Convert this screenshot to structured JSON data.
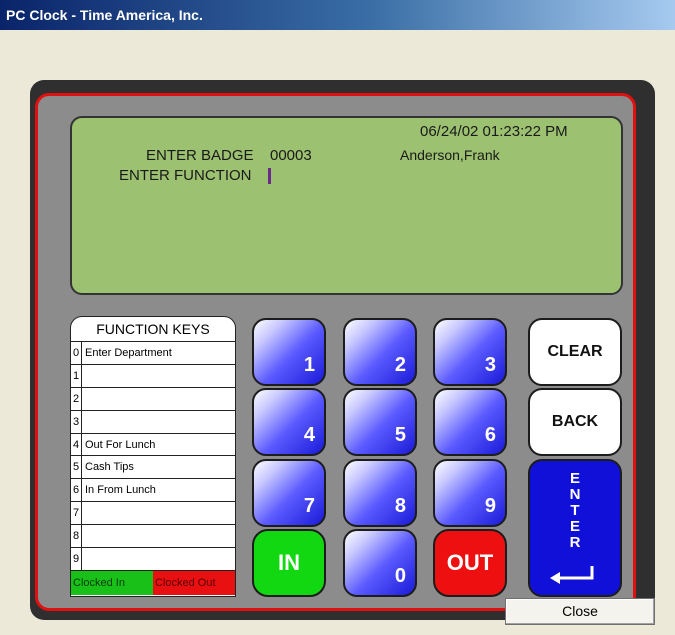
{
  "window": {
    "title": "PC Clock - Time America, Inc."
  },
  "display": {
    "datetime": "06/24/02 01:23:22 PM",
    "badge_label": "ENTER BADGE",
    "badge_value": "00003",
    "employee_name": "Anderson,Frank",
    "function_label": "ENTER FUNCTION"
  },
  "function_keys": {
    "title": "FUNCTION KEYS",
    "rows": [
      {
        "num": "0",
        "label": "Enter Department"
      },
      {
        "num": "1",
        "label": ""
      },
      {
        "num": "2",
        "label": ""
      },
      {
        "num": "3",
        "label": ""
      },
      {
        "num": "4",
        "label": "Out For Lunch"
      },
      {
        "num": "5",
        "label": "Cash Tips"
      },
      {
        "num": "6",
        "label": "In From Lunch"
      },
      {
        "num": "7",
        "label": ""
      },
      {
        "num": "8",
        "label": ""
      },
      {
        "num": "9",
        "label": ""
      }
    ],
    "status_in": "Clocked In",
    "status_out": "Clocked Out"
  },
  "keypad": {
    "k1": "1",
    "k2": "2",
    "k3": "3",
    "k4": "4",
    "k5": "5",
    "k6": "6",
    "k7": "7",
    "k8": "8",
    "k9": "9",
    "k0": "0",
    "in": "IN",
    "out": "OUT",
    "clear": "CLEAR",
    "back": "BACK",
    "enter": [
      "E",
      "N",
      "T",
      "E",
      "R"
    ]
  },
  "footer": {
    "close": "Close"
  },
  "colors": {
    "lcd": "#9cc170",
    "panel_border": "#e01010",
    "in": "#12d812",
    "out": "#ee1010",
    "enter": "#1010d8",
    "keys": "#3a3aff"
  }
}
